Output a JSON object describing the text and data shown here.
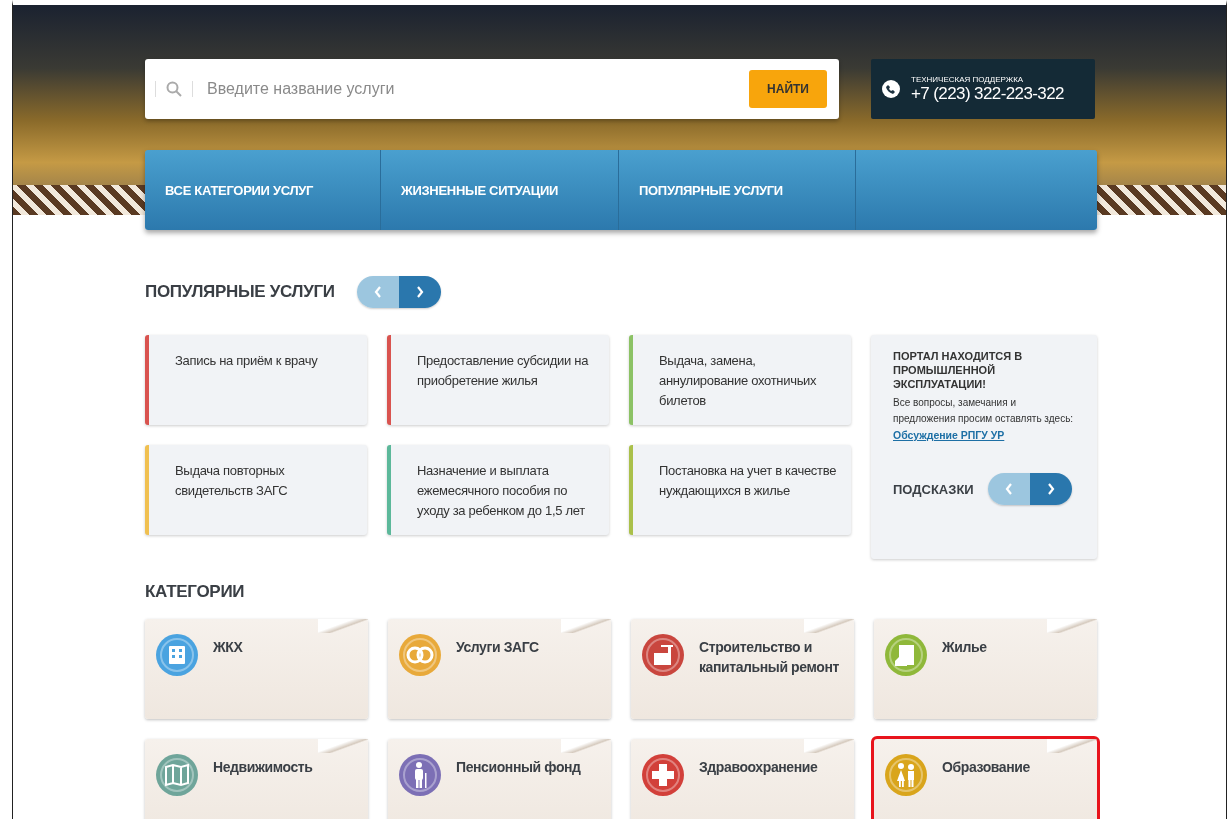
{
  "search": {
    "placeholder": "Введите название услуги",
    "button": "НАЙТИ"
  },
  "support": {
    "label": "ТЕХНИЧЕСКАЯ ПОДДЕРЖКА",
    "phone": "+7 (223) 322-223-322"
  },
  "nav": [
    {
      "label": "ВСЕ КАТЕГОРИИ УСЛУГ"
    },
    {
      "label": "ЖИЗНЕННЫЕ СИТУАЦИИ"
    },
    {
      "label": "ПОПУЛЯРНЫЕ УСЛУГИ"
    }
  ],
  "popular": {
    "title": "ПОПУЛЯРНЫЕ УСЛУГИ",
    "items": [
      {
        "text": "Запись на приём к врачу",
        "color": "#d9534f"
      },
      {
        "text": "Предоставление субсидии на приобретение жилья",
        "color": "#d9534f"
      },
      {
        "text": "Выдача, замена, аннулирование охотничьих билетов",
        "color": "#8cc265"
      },
      {
        "text": "Выдача повторных свидетельств ЗАГС",
        "color": "#f0c050"
      },
      {
        "text": "Назначение и выплата ежемесячного пособия по уходу за ребенком до 1,5 лет",
        "color": "#5cb89a"
      },
      {
        "text": "Постановка на учет в качестве нуждающихся в жилье",
        "color": "#aac04a"
      }
    ]
  },
  "notice": {
    "title": "ПОРТАЛ НАХОДИТСЯ В ПРОМЫШЛЕННОЙ ЭКСПЛУАТАЦИИ!",
    "text": "Все вопросы, замечания и предложения просим оставлять здесь:",
    "link": "Обсуждение РПГУ УР",
    "hints": "ПОДСКАЗКИ"
  },
  "categories": {
    "title": "КАТЕГОРИИ",
    "items": [
      {
        "label": "ЖКХ",
        "kind": "building",
        "color": "#4aa3e0",
        "highlighted": false
      },
      {
        "label": "Услуги ЗАГС",
        "kind": "rings",
        "color": "#e8a93a",
        "highlighted": false
      },
      {
        "label": "Строительство и капитальный ремонт",
        "kind": "crane",
        "color": "#c9463e",
        "highlighted": false
      },
      {
        "label": "Жилье",
        "kind": "house",
        "color": "#8fb83a",
        "highlighted": false
      },
      {
        "label": "Недвижимость",
        "kind": "map",
        "color": "#6fa59a",
        "highlighted": false
      },
      {
        "label": "Пенсионный фонд",
        "kind": "elder",
        "color": "#7c6fb5",
        "highlighted": false
      },
      {
        "label": "Здравоохранение",
        "kind": "cross",
        "color": "#d2403a",
        "highlighted": false
      },
      {
        "label": "Образование",
        "kind": "children",
        "color": "#d9a51c",
        "highlighted": true
      }
    ]
  }
}
